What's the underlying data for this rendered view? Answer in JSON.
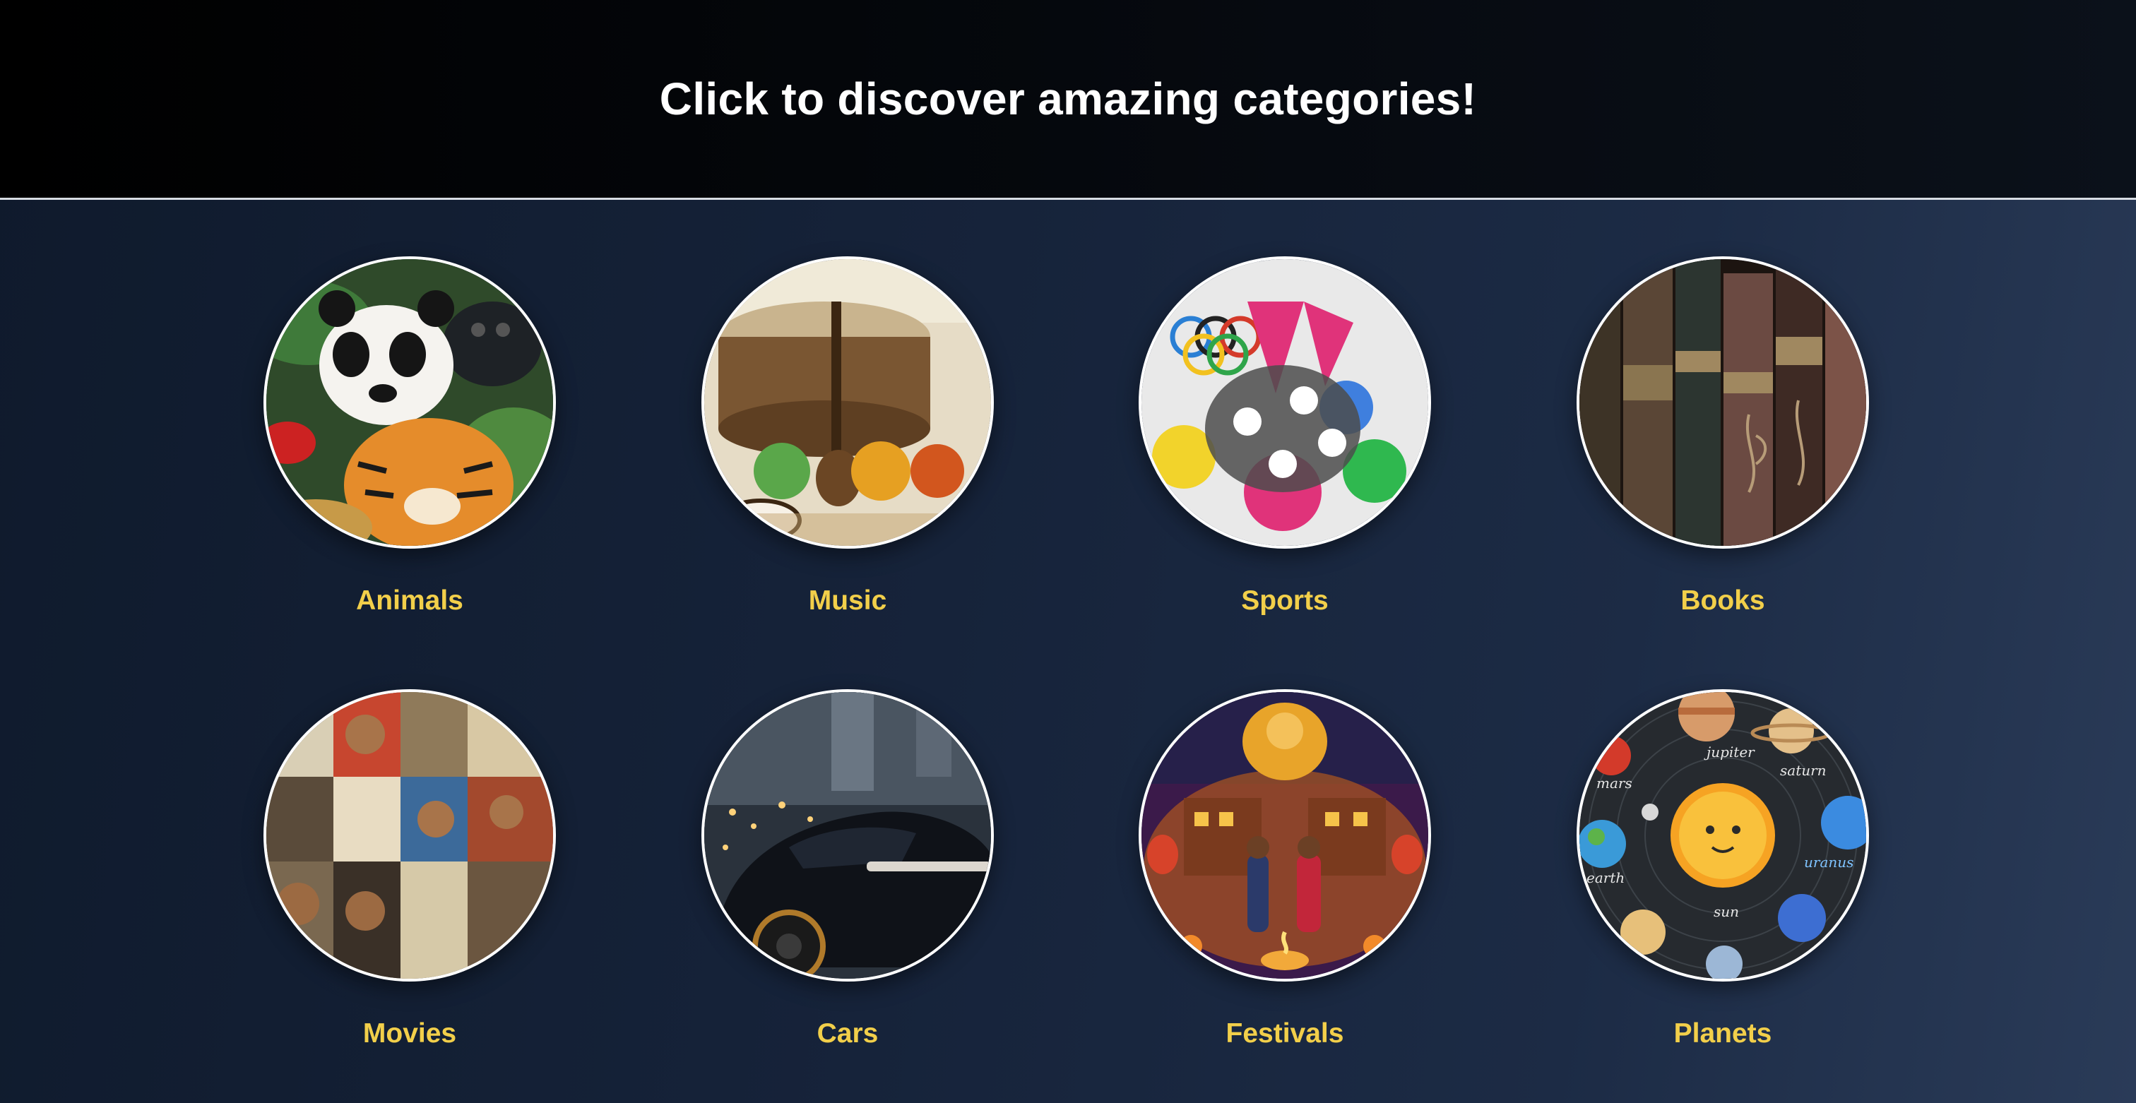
{
  "header": {
    "title": "Click to discover amazing categories!"
  },
  "colors": {
    "header_bg": "#000000",
    "page_bg_start": "#0f1a2c",
    "page_bg_end": "#2a3b58",
    "title_text": "#ffffff",
    "label_text": "#f2cf4a",
    "circle_border": "#ffffff"
  },
  "categories": [
    {
      "label": "Animals",
      "icon": "animals-icon"
    },
    {
      "label": "Music",
      "icon": "music-icon"
    },
    {
      "label": "Sports",
      "icon": "sports-icon"
    },
    {
      "label": "Books",
      "icon": "books-icon"
    },
    {
      "label": "Movies",
      "icon": "movies-icon"
    },
    {
      "label": "Cars",
      "icon": "cars-icon"
    },
    {
      "label": "Festivals",
      "icon": "festivals-icon"
    },
    {
      "label": "Planets",
      "icon": "planets-icon"
    }
  ],
  "planets_image_labels": [
    "jupiter",
    "saturn",
    "mars",
    "earth",
    "uranus",
    "sun"
  ]
}
